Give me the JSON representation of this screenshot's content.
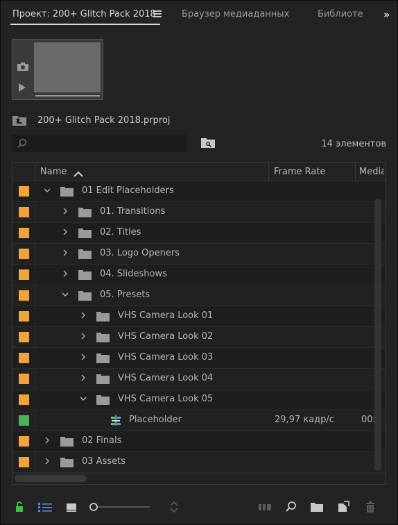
{
  "tabs": [
    {
      "label": "Проект: 200+ Glitch Pack 2018",
      "active": true
    },
    {
      "label": "Браузер медиаданных",
      "active": false
    },
    {
      "label": "Библиотеки",
      "active": false
    }
  ],
  "project": {
    "file_name": "200+ Glitch Pack 2018.prproj",
    "item_count": "14 элементов"
  },
  "search": {
    "value": "",
    "placeholder": ""
  },
  "columns": {
    "name": "Name",
    "frame_rate": "Frame Rate",
    "media": "Media"
  },
  "colors": {
    "orange_label": "#f0a43b",
    "green_label": "#4caf5a",
    "lock_green": "#3fbf4a",
    "list_view_blue": "#4a90e2"
  },
  "rows": [
    {
      "name": "01 Edit Placeholders",
      "type": "folder",
      "label_color": "orange",
      "expanded": true,
      "level": 0,
      "frame_rate": "",
      "media": ""
    },
    {
      "name": "01. Transitions",
      "type": "folder",
      "label_color": "orange",
      "expanded": false,
      "level": 1,
      "frame_rate": "",
      "media": ""
    },
    {
      "name": "02. Titles",
      "type": "folder",
      "label_color": "orange",
      "expanded": false,
      "level": 1,
      "frame_rate": "",
      "media": ""
    },
    {
      "name": "03. Logo Openers",
      "type": "folder",
      "label_color": "orange",
      "expanded": false,
      "level": 1,
      "frame_rate": "",
      "media": ""
    },
    {
      "name": "04. Slideshows",
      "type": "folder",
      "label_color": "orange",
      "expanded": false,
      "level": 1,
      "frame_rate": "",
      "media": ""
    },
    {
      "name": "05. Presets",
      "type": "folder",
      "label_color": "orange",
      "expanded": true,
      "level": 1,
      "frame_rate": "",
      "media": ""
    },
    {
      "name": "VHS Camera Look 01",
      "type": "folder",
      "label_color": "orange",
      "expanded": false,
      "level": 2,
      "frame_rate": "",
      "media": ""
    },
    {
      "name": "VHS Camera Look 02",
      "type": "folder",
      "label_color": "orange",
      "expanded": false,
      "level": 2,
      "frame_rate": "",
      "media": ""
    },
    {
      "name": "VHS Camera Look 03",
      "type": "folder",
      "label_color": "orange",
      "expanded": false,
      "level": 2,
      "frame_rate": "",
      "media": ""
    },
    {
      "name": "VHS Camera Look 04",
      "type": "folder",
      "label_color": "orange",
      "expanded": false,
      "level": 2,
      "frame_rate": "",
      "media": ""
    },
    {
      "name": "VHS Camera Look 05",
      "type": "folder",
      "label_color": "orange",
      "expanded": true,
      "level": 2,
      "frame_rate": "",
      "media": ""
    },
    {
      "name": "Placeholder",
      "type": "sequence",
      "label_color": "green",
      "expanded": false,
      "level": 3,
      "frame_rate": "29,97 кадр/с",
      "media": "00:"
    },
    {
      "name": "02 Finals",
      "type": "folder",
      "label_color": "orange",
      "expanded": false,
      "level": 0,
      "frame_rate": "",
      "media": ""
    },
    {
      "name": "03 Assets",
      "type": "folder",
      "label_color": "orange",
      "expanded": false,
      "level": 0,
      "frame_rate": "",
      "media": ""
    }
  ],
  "footer_icons": [
    "lock-icon",
    "list-view-icon",
    "icon-view-icon",
    "zoom-slider",
    "sort-icons-icon",
    "automate-to-sequence-icon",
    "find-icon",
    "new-bin-icon",
    "new-item-icon",
    "clear-icon"
  ]
}
